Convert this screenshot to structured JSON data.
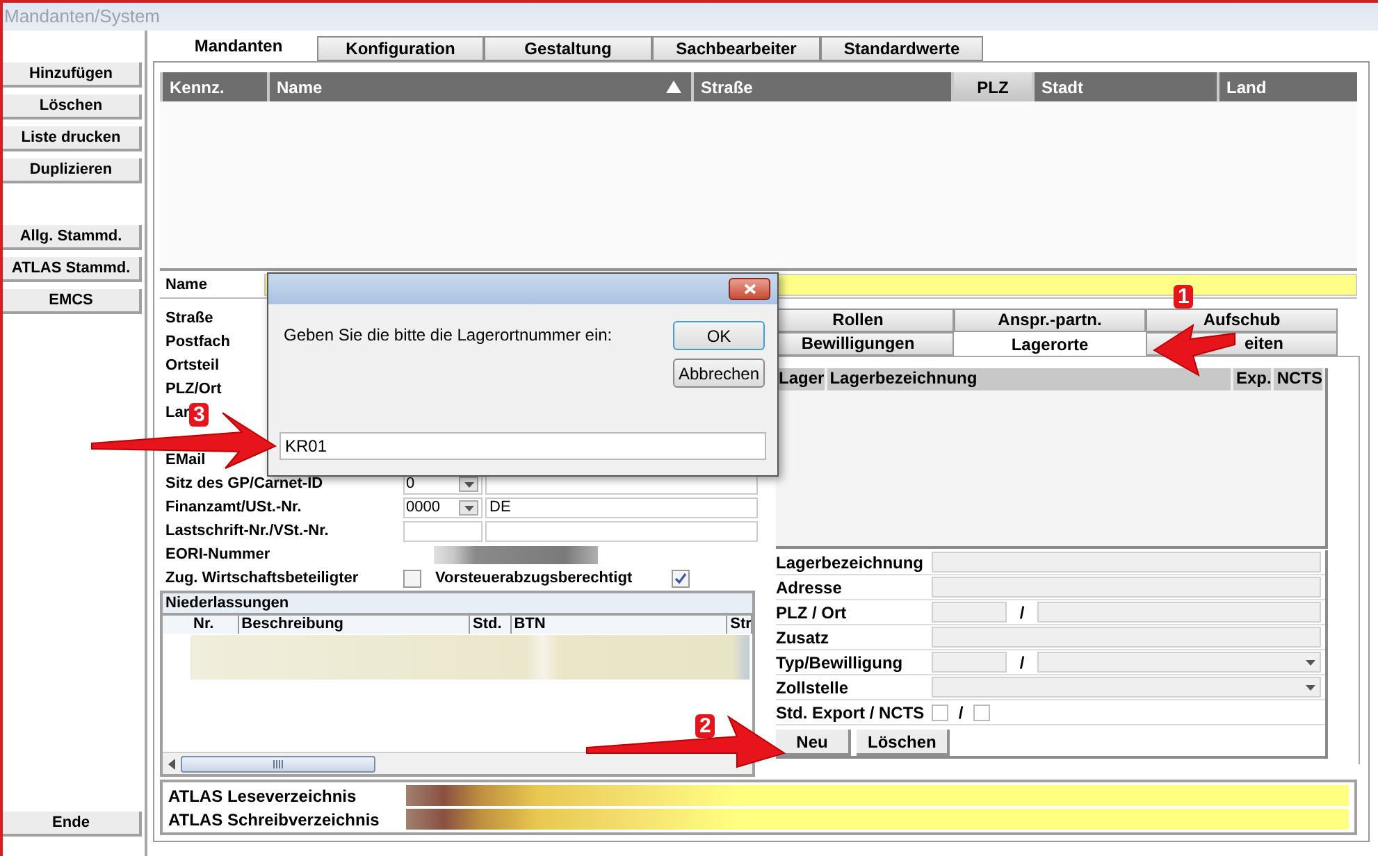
{
  "window": {
    "title": "Mandanten/System"
  },
  "sidebar": {
    "top_buttons": [
      "Hinzufügen",
      "Löschen",
      "Liste drucken",
      "Duplizieren"
    ],
    "stammdaten_buttons": [
      "Allg. Stammd.",
      "ATLAS Stammd.",
      "EMCS"
    ],
    "bottom_button": "Ende"
  },
  "tabs": [
    {
      "label": "Mandanten",
      "selected": true
    },
    {
      "label": "Konfiguration",
      "selected": false
    },
    {
      "label": "Gestaltung",
      "selected": false
    },
    {
      "label": "Sachbearbeiter",
      "selected": false
    },
    {
      "label": "Standardwerte",
      "selected": false
    }
  ],
  "table": {
    "columns": [
      {
        "label": "Kennz.",
        "sorted": false,
        "selected": false
      },
      {
        "label": "Name",
        "sorted": true,
        "selected": false
      },
      {
        "label": "Straße",
        "sorted": false,
        "selected": false
      },
      {
        "label": "PLZ",
        "sorted": false,
        "selected": true
      },
      {
        "label": "Stadt",
        "sorted": false,
        "selected": false
      },
      {
        "label": "Land",
        "sorted": false,
        "selected": false
      }
    ]
  },
  "name_field": {
    "label": "Name"
  },
  "address_rows": [
    {
      "kind": "labeled",
      "label": "Straße"
    },
    {
      "kind": "labeled",
      "label": "Postfach"
    },
    {
      "kind": "labeled",
      "label": "Ortsteil"
    },
    {
      "kind": "labeled",
      "label": "PLZ/Ort"
    },
    {
      "kind": "labeled",
      "label": "Lar"
    },
    {
      "kind": "covered"
    },
    {
      "kind": "labeled",
      "label": "EMail"
    }
  ],
  "tax_rows": [
    {
      "label": "Sitz des GP/Carnet-ID",
      "kind": "combo",
      "code": "0",
      "value": ""
    },
    {
      "label": "Finanzamt/USt.-Nr.",
      "kind": "combo",
      "code": "0000",
      "value": "DE"
    },
    {
      "label": "Lastschrift-Nr./VSt.-Nr.",
      "kind": "text"
    },
    {
      "label": "EORI-Nummer",
      "kind": "blurred"
    }
  ],
  "flags": [
    {
      "label": "Zug. Wirtschaftsbeteiligter",
      "checked": false
    },
    {
      "label": "Vorsteuerabzugsberechtigt",
      "checked": true
    }
  ],
  "branches": {
    "title": "Niederlassungen",
    "columns": [
      "Nr.",
      "Beschreibung",
      "Std.",
      "BTN",
      "Str"
    ]
  },
  "atlas": {
    "labels": [
      "ATLAS Leseverzeichnis",
      "ATLAS Schreibverzeichnis"
    ]
  },
  "detail_tabs": [
    [
      {
        "label": "Rollen",
        "selected": false
      },
      {
        "label": "Anspr.-partn.",
        "selected": false
      },
      {
        "label": "Aufschub",
        "selected": false
      }
    ],
    [
      {
        "label": "Bewilligungen",
        "selected": false
      },
      {
        "label": "Lagerorte",
        "selected": true
      },
      {
        "label": "eiten",
        "selected": false,
        "covered_left": true
      }
    ]
  ],
  "storage": {
    "columns": [
      "Lager",
      "Lagerbezeichnung",
      "Exp.",
      "NCTS"
    ],
    "fields": [
      {
        "label": "Lagerbezeichnung",
        "kind": "text"
      },
      {
        "label": "Adresse",
        "kind": "text"
      },
      {
        "label": "PLZ / Ort",
        "kind": "pair",
        "separator": "/"
      },
      {
        "label": "Zusatz",
        "kind": "text"
      },
      {
        "label": "Typ/Bewilligung",
        "kind": "pair_combo",
        "separator": "/"
      },
      {
        "label": "Zollstelle",
        "kind": "combo"
      },
      {
        "label": "Std. Export / NCTS",
        "kind": "checks",
        "separator": "/",
        "checks": [
          {
            "checked": false
          },
          {
            "checked": false
          }
        ]
      }
    ],
    "buttons": [
      "Neu",
      "Löschen"
    ]
  },
  "dialog": {
    "message": "Geben Sie die bitte die Lagerortnummer ein:",
    "buttons": [
      "OK",
      "Abbrechen"
    ],
    "value": "KR01"
  },
  "annotations": [
    {
      "label": "1"
    },
    {
      "label": "2"
    },
    {
      "label": "3"
    }
  ]
}
